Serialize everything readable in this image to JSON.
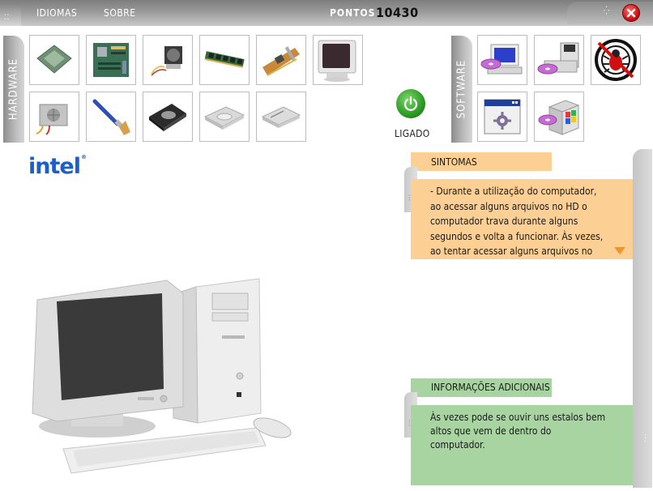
{
  "menu": {
    "languages": "IDIOMAS",
    "about": "SOBRE"
  },
  "score": {
    "label": "PONTOS",
    "value": "10430"
  },
  "hardware": {
    "tab_label": "HARDWARE",
    "items": [
      {
        "name": "processor",
        "icon": "cpu-icon"
      },
      {
        "name": "motherboard",
        "icon": "motherboard-icon"
      },
      {
        "name": "cpu-cooler",
        "icon": "cooler-fan-icon"
      },
      {
        "name": "memory",
        "icon": "ram-icon"
      },
      {
        "name": "expansion-card",
        "icon": "pci-card-icon"
      },
      {
        "name": "monitor",
        "icon": "crt-monitor-icon"
      },
      {
        "name": "power-supply",
        "icon": "power-supply-icon"
      },
      {
        "name": "brush",
        "icon": "cleaning-brush-icon"
      },
      {
        "name": "hard-disk",
        "icon": "hard-disk-icon"
      },
      {
        "name": "optical-drive",
        "icon": "cd-drive-icon"
      },
      {
        "name": "floppy-drive",
        "icon": "floppy-drive-icon"
      }
    ]
  },
  "software": {
    "tab_label": "SOFTWARE",
    "items": [
      {
        "name": "install-software",
        "icon": "computer-cd-install-icon"
      },
      {
        "name": "backup",
        "icon": "floppy-backup-icon"
      },
      {
        "name": "antivirus",
        "icon": "virus-scan-icon"
      },
      {
        "name": "settings-program",
        "icon": "window-gear-icon"
      },
      {
        "name": "software-box",
        "icon": "software-box-icon"
      }
    ]
  },
  "power": {
    "label": "LIGADO",
    "color": "#2c9a25"
  },
  "brand": "intel",
  "symptoms": {
    "title": "SINTOMAS",
    "text": "- Durante a utilização do computador, ao acessar alguns arquivos no HD o computador trava durante alguns segundos e volta a funcionar. Às vezes, ao tentar acessar alguns arquivos no HD",
    "color": "#fccf94"
  },
  "additional_info": {
    "title": "INFORMAÇÕES ADICIONAIS",
    "text": "Às vezes pode se ouvir uns estalos bem altos que vem de dentro do computador.",
    "color": "#a8d4a2"
  }
}
